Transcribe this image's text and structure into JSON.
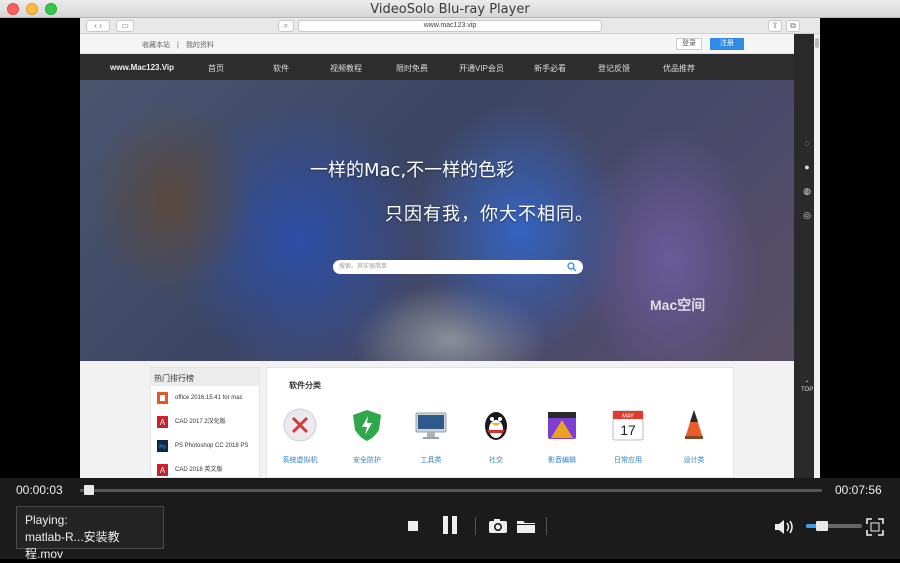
{
  "app": {
    "title": "VideoSolo Blu-ray Player"
  },
  "browser": {
    "url": "www.mac123.vip"
  },
  "site": {
    "util_links": "收藏本站　|　我的资料",
    "login": "登录",
    "register": "注册",
    "logo": "www.Mac123.Vip",
    "nav": [
      "首页",
      "软件",
      "视频教程",
      "限时免费",
      "开通VIP会员",
      "新手必看",
      "登记反馈",
      "优品推荐"
    ],
    "hero_line1": "一样的Mac,不一样的色彩",
    "hero_line2": "只因有我，你大不相同。",
    "search_placeholder": "搜索。其实很简单",
    "watermark": "Mac空间",
    "top_label": "TOP",
    "hot_title": "热门排行榜",
    "hot_items": [
      "office 2016.15.41 for mac",
      "CAD 2017.2汉化版",
      "PS Photoshop CC 2018 PS",
      "CAD 2018 英文版"
    ],
    "cat_title": "软件分类",
    "categories": [
      "系统虚拟机",
      "安全防护",
      "工具类",
      "社交",
      "影音编辑",
      "日常应用",
      "设计类"
    ],
    "calendar_day": "17",
    "calendar_month": "MAY"
  },
  "player": {
    "elapsed": "00:00:03",
    "duration": "00:07:56",
    "progress": 0.006,
    "playing_label": "Playing:",
    "file_name": "matlab-R...安装教程.mov",
    "volume": 0.25,
    "accent": "#3aa0e8"
  }
}
